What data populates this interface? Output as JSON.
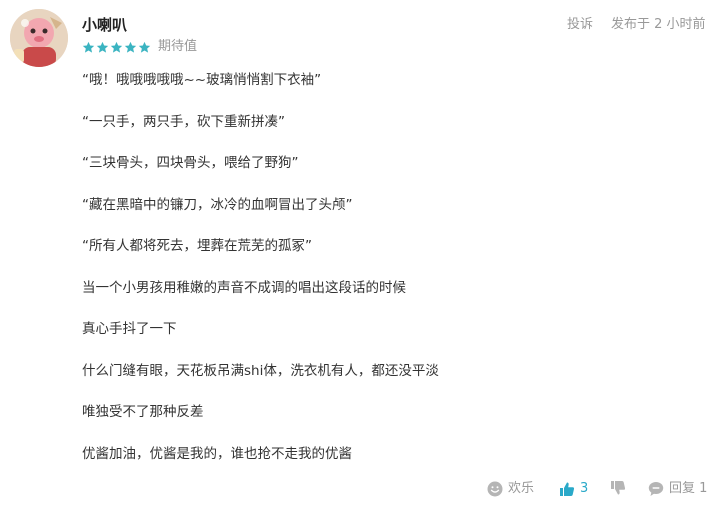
{
  "review": {
    "username": "小喇叭",
    "rating_label": "期待值",
    "stars": 5,
    "report_label": "投诉",
    "timestamp": "发布于 2 小时前",
    "paragraphs": [
      "“哦！哦哦哦哦哦~~玻璃悄悄割下衣袖”",
      "“一只手，两只手，砍下重新拼凑”",
      "“三块骨头，四块骨头，喂给了野狗”",
      "“藏在黑暗中的镰刀，冰冷的血啊冒出了头颅”",
      "“所有人都将死去，埋葬在荒芜的孤冢”",
      "当一个小男孩用稚嫩的声音不成调的唱出这段话的时候",
      "真心手抖了一下",
      "什么门缝有眼，天花板吊满shi体，洗衣机有人，都还没平淡",
      "唯独受不了那种反差",
      "优酱加油，优酱是我的，谁也抢不走我的优酱"
    ]
  },
  "actions": {
    "fun_label": "欢乐",
    "like_count": "3",
    "reply_label": "回复 1"
  },
  "colors": {
    "star": "#3bb4c1",
    "like": "#2aa9c9",
    "muted": "#999999",
    "text": "#333333"
  },
  "icons": [
    "avatar-image",
    "star-icon",
    "smile-icon",
    "thumbs-up-icon",
    "thumbs-down-icon",
    "comment-icon"
  ]
}
